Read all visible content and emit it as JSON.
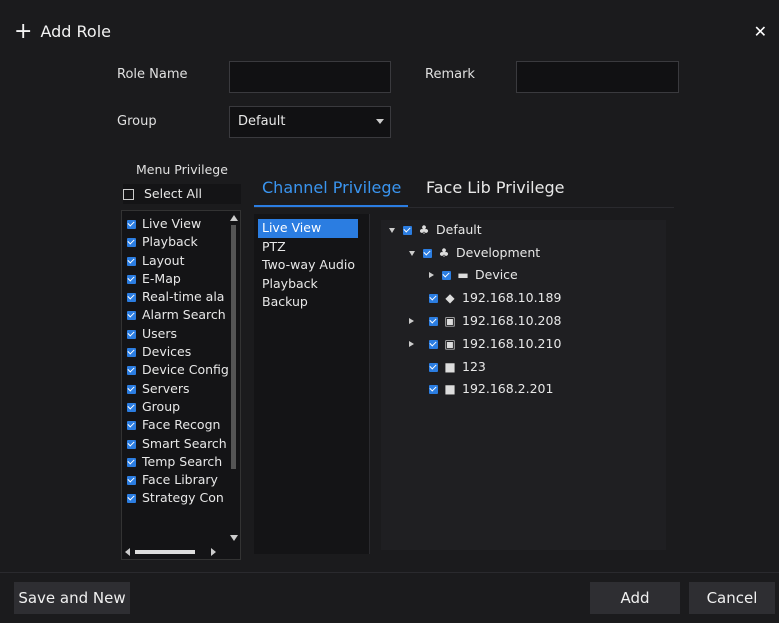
{
  "dialog": {
    "title": "Add Role",
    "close_glyph": "✕"
  },
  "form": {
    "role_name_label": "Role Name",
    "role_name_value": "",
    "remark_label": "Remark",
    "remark_value": "",
    "group_label": "Group",
    "group_value": "Default"
  },
  "menu_privilege": {
    "title": "Menu Privilege",
    "select_all": "Select All",
    "items": [
      "Live View",
      "Playback",
      "Layout",
      "E-Map",
      "Real-time ala",
      "Alarm Search",
      "Users",
      "Devices",
      "Device Config",
      "Servers",
      "Group",
      "Face Recogn",
      "Smart Search",
      "Temp Search",
      "Face Library",
      "Strategy Con"
    ]
  },
  "tabs": {
    "channel": "Channel Privilege",
    "facelib": "Face Lib Privilege"
  },
  "sub_privileges": [
    "Live View",
    "PTZ",
    "Two-way Audio",
    "Playback",
    "Backup"
  ],
  "tree": {
    "root": "Default",
    "development": "Development",
    "device": "Device",
    "ip1": "192.168.10.189",
    "ip2": "192.168.10.208",
    "ip3": "192.168.10.210",
    "num": "123",
    "ip4": "192.168.2.201"
  },
  "footer": {
    "save_new": "Save and New",
    "add": "Add",
    "cancel": "Cancel"
  },
  "colors": {
    "accent": "#2b7de1",
    "background": "#1b1b1d"
  }
}
